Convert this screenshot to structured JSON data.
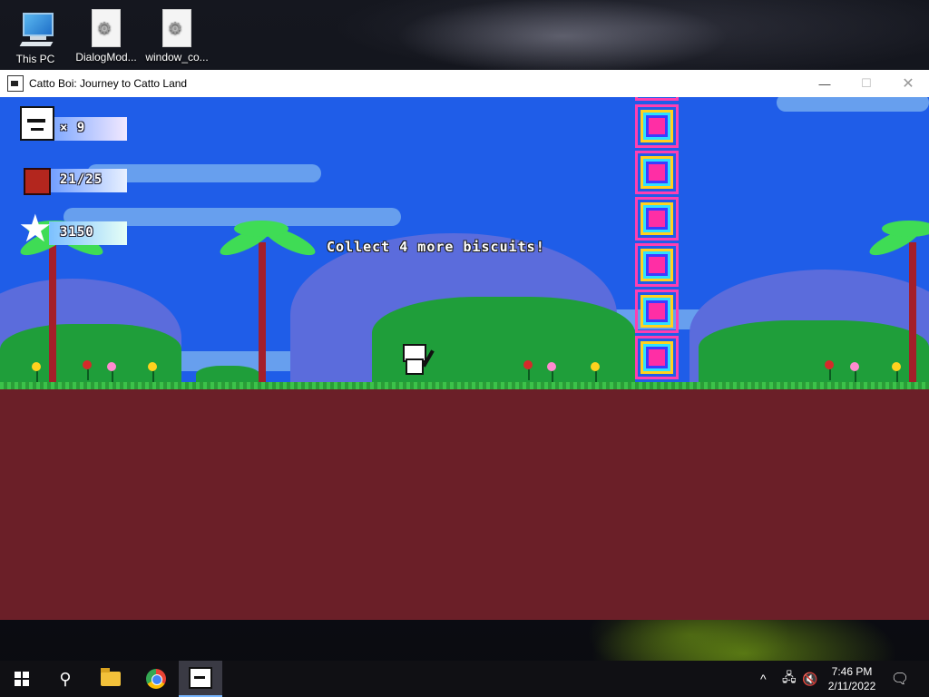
{
  "desktop": {
    "icons": [
      {
        "label": "This PC"
      },
      {
        "label": "DialogMod..."
      },
      {
        "label": "window_co..."
      }
    ]
  },
  "window": {
    "title": "Catto Boi: Journey to Catto Land",
    "controls": {
      "minimize": "—",
      "maximize": "☐",
      "close": "✕"
    }
  },
  "game": {
    "hud": {
      "lives": "× 9",
      "biscuits": "21/25",
      "score": "3150"
    },
    "message": "Collect 4 more biscuits!",
    "colors": {
      "sky": "#1f5de8",
      "ground": "#6b1f28",
      "grass": "#3cc24a"
    }
  },
  "taskbar": {
    "icons": [
      "start-icon",
      "search-icon",
      "file-explorer-icon",
      "chrome-icon",
      "catto-boi-app-icon"
    ],
    "tray": {
      "chevron": "^"
    },
    "time": "7:46 PM",
    "date": "2/11/2022"
  }
}
